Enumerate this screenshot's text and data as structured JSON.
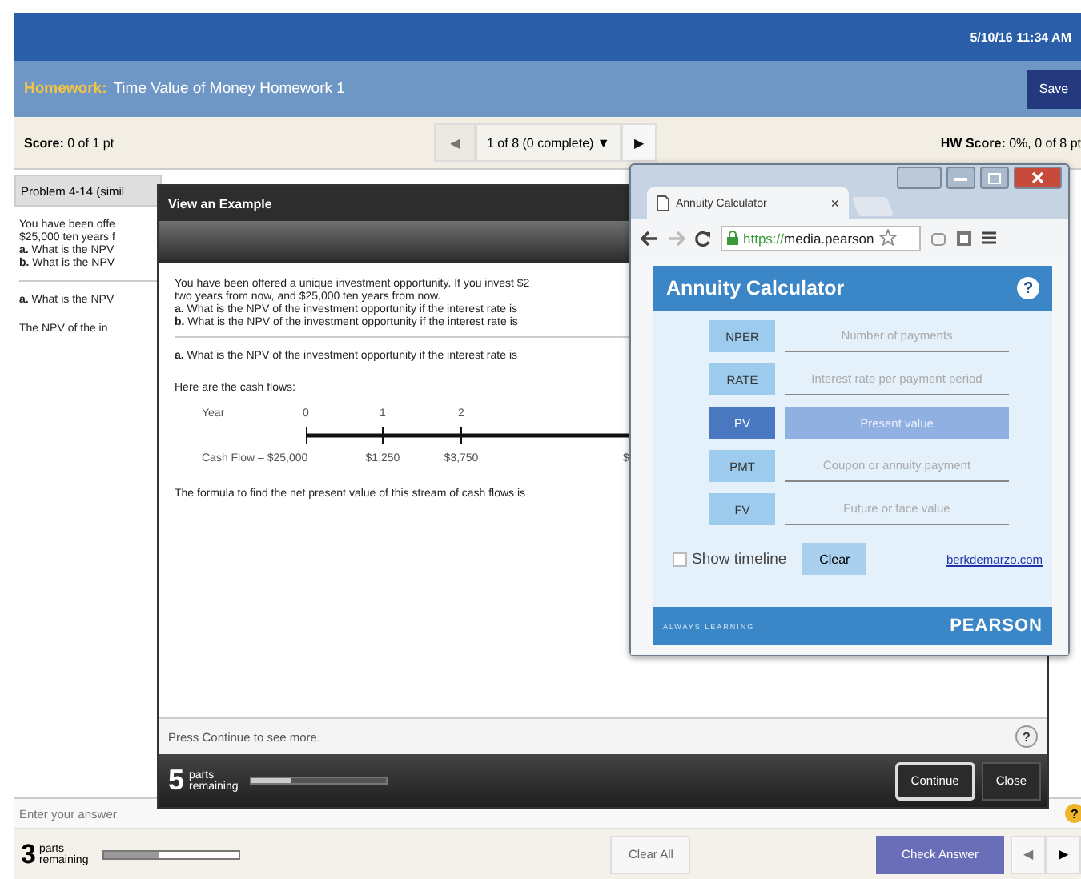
{
  "top_bar": {
    "datetime": "5/10/16 11:34 AM"
  },
  "header": {
    "label": "Homework:",
    "title": "Time Value of Money Homework 1",
    "save_button": "Save"
  },
  "score_bar": {
    "score": "**Score:** 0 of 1 pt",
    "prev": "◀",
    "question_selector": "1 of 8 (0 complete)",
    "caret": "▼",
    "next": "▶",
    "hw_score": "**HW Score:** 0%, 0 of 8 pt"
  },
  "problem": {
    "tab": "Problem 4-14 (simil",
    "lines": [
      "You have been offe",
      "$25,000 ten years f",
      "**a.** What is the NPV",
      "**b.** What is the NPV"
    ],
    "question": "**a.** What is the NPV",
    "answer_text": "The NPV of the  in"
  },
  "answer_bar": {
    "placeholder": "Enter your answer",
    "help": "?"
  },
  "bottom_bar": {
    "parts_count": "3",
    "parts_label": "parts remaining",
    "level": 0.4,
    "clear_all": "Clear All",
    "check_answer": "Check Answer",
    "prev": "◀",
    "next": "▶"
  },
  "example_modal": {
    "title": "View an Example",
    "intro": [
      "You have been offered a unique investment opportunity. If you invest $2",
      "two years from now, and $25,000 ten years from now.",
      "**a.** What is the NPV of the  investment opportunity  if the interest rate is",
      "**b.** What is the NPV of the  investment opportunity  if the interest rate is"
    ],
    "question": "**a.** What is the NPV of the  investment opportunity  if the interest rate is",
    "cash_flow_heading": "Here are the cash flows:",
    "timeline": {
      "year_label": "Year",
      "years": [
        "0",
        "1",
        "2"
      ],
      "cash_flow_label": "Cash Flow",
      "cash_flows": [
        "– $25,000",
        "$1,250",
        "$3,750",
        "$"
      ]
    },
    "formula_text": "The formula to find the net present value of this stream of cash flows is",
    "hint": "Press Continue to see more.",
    "help": "?",
    "parts_count": "5",
    "parts_label": "parts remaining",
    "level": 0.3,
    "buttons": [
      {
        "label": "Continue",
        "focused": true
      },
      {
        "label": "Close",
        "focused": false
      }
    ]
  },
  "calculator_window": {
    "tab_title": "Annuity Calculator",
    "tab_close": "×",
    "url_scheme": "https://",
    "url_host": "media.pearson",
    "calculator": {
      "title": "Annuity Calculator",
      "help": "?",
      "rows": [
        {
          "key": "NPER",
          "placeholder": "Number of payments",
          "selected": false
        },
        {
          "key": "RATE",
          "placeholder": "Interest rate per payment period",
          "selected": false
        },
        {
          "key": "PV",
          "placeholder": "Present value",
          "selected": true
        },
        {
          "key": "PMT",
          "placeholder": "Coupon or annuity payment",
          "selected": false
        },
        {
          "key": "FV",
          "placeholder": "Future or face value",
          "selected": false
        }
      ],
      "show_timeline": {
        "label": "Show timeline",
        "checked": false
      },
      "clear_button": "Clear",
      "link": "berkdemarzo.com",
      "footer_left": "ALWAYS LEARNING",
      "footer_right": "PEARSON"
    }
  }
}
